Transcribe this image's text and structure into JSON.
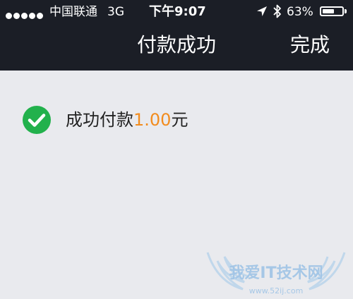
{
  "status_bar": {
    "carrier": "中国联通",
    "network": "3G",
    "time": "下午9:07",
    "battery_percent": "63%",
    "battery_level": 0.63
  },
  "nav": {
    "title": "付款成功",
    "done_label": "完成"
  },
  "content": {
    "success_prefix": "成功付款",
    "amount": "1.00",
    "currency": "元"
  },
  "watermark": {
    "text": "我爱IT技术网",
    "url": "www.52ij.com"
  },
  "colors": {
    "nav_background": "#1b1e26",
    "page_background": "#e9eaee",
    "success_green": "#22b14c",
    "amount_orange": "#f28c1e"
  },
  "icons": [
    "signal-dot-icon",
    "location-arrow-icon",
    "bluetooth-icon",
    "battery-icon",
    "check-circle-icon"
  ]
}
